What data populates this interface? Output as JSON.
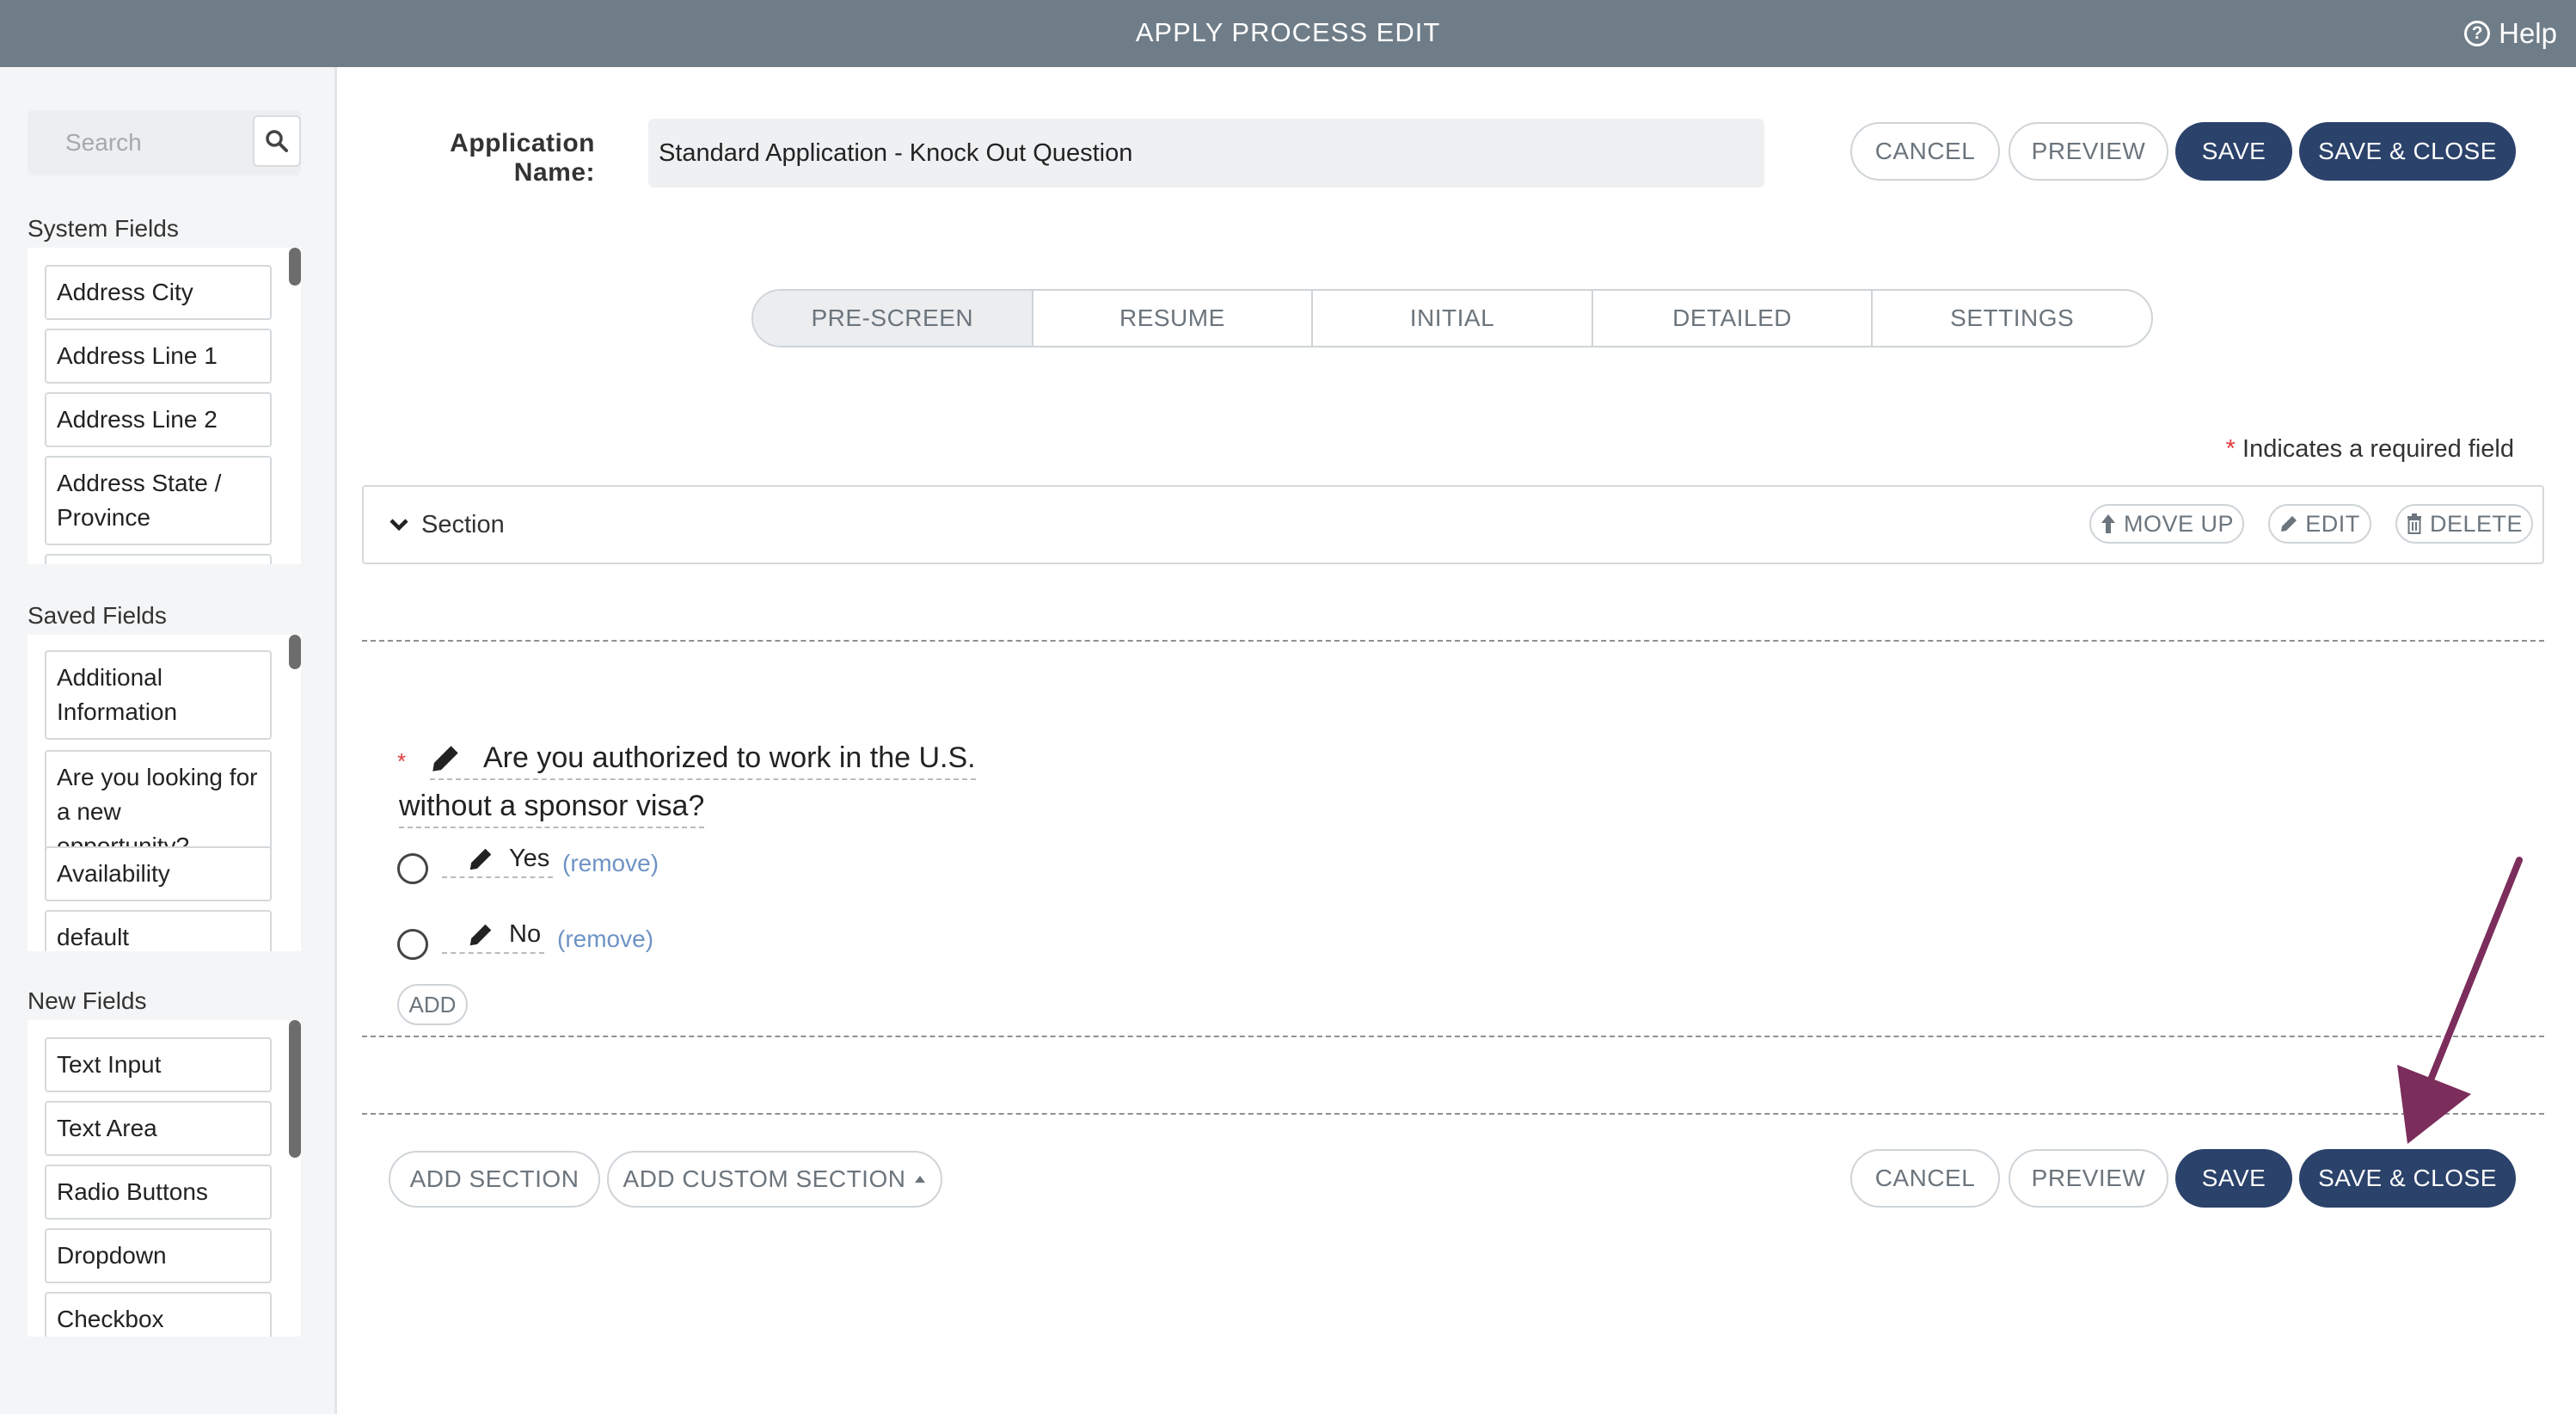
{
  "topbar": {
    "title": "APPLY PROCESS EDIT",
    "help_label": "Help"
  },
  "sidebar": {
    "search_placeholder": "Search",
    "system_fields": {
      "title": "System Fields",
      "items": [
        "Address City",
        "Address Line 1",
        "Address Line 2",
        "Address State / Province"
      ]
    },
    "saved_fields": {
      "title": "Saved Fields",
      "items": [
        "Additional Information",
        "Are you looking for a new opportunity?",
        "Availability",
        "default"
      ]
    },
    "new_fields": {
      "title": "New Fields",
      "items": [
        "Text Input",
        "Text Area",
        "Radio Buttons",
        "Dropdown",
        "Checkbox"
      ]
    }
  },
  "header": {
    "app_name_label": "Application Name:",
    "app_name_value": "Standard Application - Knock Out Question",
    "cancel_label": "CANCEL",
    "preview_label": "PREVIEW",
    "save_label": "SAVE",
    "save_close_label": "SAVE & CLOSE"
  },
  "tabs": [
    {
      "label": "PRE-SCREEN",
      "active": true
    },
    {
      "label": "RESUME",
      "active": false
    },
    {
      "label": "INITIAL",
      "active": false
    },
    {
      "label": "DETAILED",
      "active": false
    },
    {
      "label": "SETTINGS",
      "active": false
    }
  ],
  "required_note": {
    "star": "*",
    "text": "Indicates a required field"
  },
  "section": {
    "label": "Section",
    "move_up_label": "MOVE UP",
    "edit_label": "EDIT",
    "delete_label": "DELETE"
  },
  "question": {
    "required_star": "*",
    "text_line1": "Are you authorized to work in the U.S.",
    "text_line2": "without a sponsor visa?",
    "options": [
      {
        "label": "Yes",
        "remove_label": "(remove)"
      },
      {
        "label": "No",
        "remove_label": "(remove)"
      }
    ],
    "add_label": "ADD"
  },
  "footer": {
    "add_section_label": "ADD SECTION",
    "add_custom_section_label": "ADD CUSTOM SECTION",
    "cancel_label": "CANCEL",
    "preview_label": "PREVIEW",
    "save_label": "SAVE",
    "save_close_label": "SAVE & CLOSE"
  },
  "colors": {
    "topbar": "#6f7d88",
    "primary_button": "#2b426b",
    "annotation_arrow": "#7b2d5c",
    "required_star": "#e03b3b",
    "remove_link": "#6e93c4"
  }
}
